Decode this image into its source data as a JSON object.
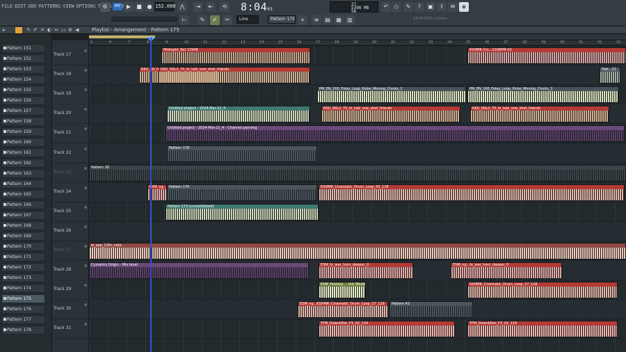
{
  "menu": [
    "FILE",
    "EDIT",
    "ADD",
    "PATTERNS",
    "VIEW",
    "OPTIONS",
    "TOOLS",
    "HELP"
  ],
  "transport": {
    "mode": "PAT",
    "tempo": "152.000",
    "time": "8:04",
    "time_sub": "05",
    "cpu": "27",
    "memory": "5396 MB",
    "voices": "56"
  },
  "toolbar": {
    "snap": "Line",
    "pattern": "Pattern 175",
    "plugin_hint": "13:04 FLEX | Colors"
  },
  "playlist": {
    "title": "Playlist - Arrangement - Pattern 175"
  },
  "ruler": [
    "5",
    "6",
    "7",
    "8",
    "9",
    "10",
    "11",
    "12",
    "13",
    "14",
    "15",
    "16",
    "17",
    "18",
    "19",
    "20",
    "21",
    "22",
    "23",
    "24",
    "25",
    "26",
    "27",
    "28",
    "29",
    "30",
    "31",
    "32",
    "33"
  ],
  "patterns": [
    {
      "label": "Pattern 151"
    },
    {
      "label": "Pattern 152"
    },
    {
      "label": "Pattern 153"
    },
    {
      "label": "Pattern 154"
    },
    {
      "label": "Pattern 155"
    },
    {
      "label": "Pattern 156"
    },
    {
      "label": "Pattern 157"
    },
    {
      "label": "Pattern 158"
    },
    {
      "label": "Pattern 159"
    },
    {
      "label": "Pattern 160"
    },
    {
      "label": "Pattern 161"
    },
    {
      "label": "Pattern 162"
    },
    {
      "label": "Pattern 163"
    },
    {
      "label": "Pattern 164"
    },
    {
      "label": "Pattern 165"
    },
    {
      "label": "Pattern 166"
    },
    {
      "label": "Pattern 167"
    },
    {
      "label": "Pattern 168"
    },
    {
      "label": "Pattern 169"
    },
    {
      "label": "Pattern 170"
    },
    {
      "label": "Pattern 171"
    },
    {
      "label": "Pattern 172"
    },
    {
      "label": "Pattern 173"
    },
    {
      "label": "Pattern 174"
    },
    {
      "label": "Pattern 175",
      "selected": true
    },
    {
      "label": "Pattern 176"
    },
    {
      "label": "Pattern 177"
    },
    {
      "label": "Pattern 178"
    }
  ],
  "tracks": [
    {
      "label": "Track 17",
      "muted": false
    },
    {
      "label": "Track 18",
      "muted": false
    },
    {
      "label": "Track 19",
      "muted": false
    },
    {
      "label": "Track 20",
      "muted": false
    },
    {
      "label": "Track 21",
      "muted": false
    },
    {
      "label": "Track 22",
      "muted": false
    },
    {
      "label": "Track 23",
      "muted": true
    },
    {
      "label": "Track 24",
      "muted": false
    },
    {
      "label": "Track 25",
      "muted": false
    },
    {
      "label": "Track 26",
      "muted": false
    },
    {
      "label": "Track 27",
      "muted": true
    },
    {
      "label": "Track 28",
      "muted": false
    },
    {
      "label": "Track 29",
      "muted": false
    },
    {
      "label": "Track 30",
      "muted": false
    },
    {
      "label": "Track 31",
      "muted": false
    }
  ],
  "clips": [
    {
      "track": 0,
      "name": "Midnight_Bal 13948",
      "color": "#c8a489",
      "hdr": "#b43a35"
    },
    {
      "track": 0,
      "name": "KSHMR Cin...120BPM 03",
      "color": "#d8a3a0",
      "hdr": "#b43a35"
    },
    {
      "track": 1,
      "name": "RKU_SR_friends",
      "color": "#d3b08f",
      "hdr": "#b43a35"
    },
    {
      "track": 1,
      "name": "RKU_SRL2_75_fx_talk_one_shot_friends",
      "color": "#d3b08f",
      "hdr": "#b43a35"
    },
    {
      "track": 1,
      "name": "Patt...23",
      "color": "#9fb2a3",
      "hdr": "#4e5a5f"
    },
    {
      "track": 2,
      "name": "PM_EN_100_Foley_Loop_Pulse_Moving_Clocks_2",
      "color": "#dbe3bf",
      "hdr": "#47525a"
    },
    {
      "track": 2,
      "name": "PM_EN_100_Foley_Loop_Pulse_Moving_Clocks_2",
      "color": "#dbe3bf",
      "hdr": "#47525a"
    },
    {
      "track": 3,
      "name": "Untitled project - 2024-Mar-21_4",
      "color": "#cfd7b9",
      "hdr": "#3e7a70"
    },
    {
      "track": 3,
      "name": "RKU_SRL2_75_fx_talk_one_shot_friends",
      "color": "#d3b08f",
      "hdr": "#b43a35"
    },
    {
      "track": 3,
      "name": "RKU_SRL2_75_fx_talk_one_shot_friends",
      "color": "#d3b08f",
      "hdr": "#b43a35"
    },
    {
      "track": 4,
      "name": "Untitled project - 2024-Mar-21_4 - Channel panning",
      "color": "#5a3f66",
      "hdr": "#6b4a79"
    },
    {
      "track": 5,
      "name": "Pattern 178",
      "color": "#4a565c",
      "hdr": "#4a565c"
    },
    {
      "track": 6,
      "name": "Pattern 28",
      "color": "#3b4448",
      "hdr": "#3b4448"
    },
    {
      "track": 7,
      "name": "ESM_ng...",
      "color": "#e6a9a4",
      "hdr": "#b43a35"
    },
    {
      "track": 7,
      "name": "Pattern 176",
      "color": "#4a565c",
      "hdr": "#4a565c"
    },
    {
      "track": 7,
      "name": "KSHMR_Cinematic_Drum_Loop_43_128",
      "color": "#e6b6a8",
      "hdr": "#b43a35"
    },
    {
      "track": 8,
      "name": "Pattern 173 (consolidated)",
      "color": "#cfd7b9",
      "hdr": "#3e7a70"
    },
    {
      "track": 10,
      "name": "w_aep_13th_note",
      "color": "#f1c9b9",
      "hdr": "#8e4944"
    },
    {
      "track": 11,
      "name": "Cymatics Origin - Mix level",
      "color": "#5a3f66",
      "hdr": "#6b4a79"
    },
    {
      "track": 11,
      "name": "ESM_fx_war_horn_deeper_0",
      "color": "#e6a9a4",
      "hdr": "#b43a35"
    },
    {
      "track": 11,
      "name": "ESM_ng...fx_war_horn_deeper_0",
      "color": "#e6a9a4",
      "hdr": "#b43a35"
    },
    {
      "track": 12,
      "name": "ESM_Fantasy_...md_Medieval",
      "color": "#e8eec4",
      "hdr": "#6a7a37"
    },
    {
      "track": 12,
      "name": "KSHMR_Cinematic_Drum_Loop_27_128",
      "color": "#e6b6a8",
      "hdr": "#b43a35"
    },
    {
      "track": 13,
      "name": "ESM_ng...KSHMR_Cinematic_Drum_Loop_27_128",
      "color": "#e6b6a8",
      "hdr": "#b43a35"
    },
    {
      "track": 13,
      "name": "Pattern 43",
      "color": "#4a565c",
      "hdr": "#4a565c"
    },
    {
      "track": 14,
      "name": "TFM_Downlifter_FX_02_124",
      "color": "#f0b0aa",
      "hdr": "#b43a35"
    },
    {
      "track": 14,
      "name": "TFM_Downlifter_FX_02_124",
      "color": "#f0b0aa",
      "hdr": "#b43a35"
    }
  ]
}
